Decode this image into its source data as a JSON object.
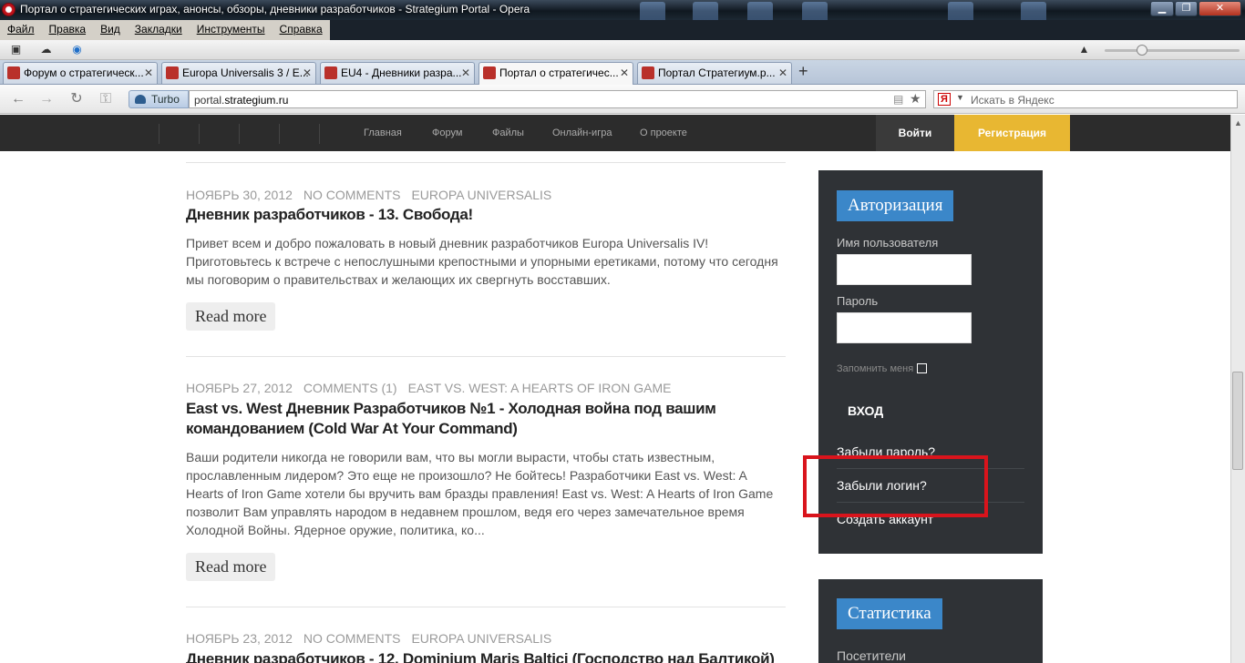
{
  "window": {
    "title": "Портал о стратегических играх, анонсы, обзоры, дневники разработчиков - Strategium Portal - Opera",
    "min_label": "▁",
    "max_label": "❐",
    "close_label": "✕"
  },
  "menu": [
    "Файл",
    "Правка",
    "Вид",
    "Закладки",
    "Инструменты",
    "Справка"
  ],
  "tabs": [
    {
      "label": "Форум о стратегическ..."
    },
    {
      "label": "Europa Universalis 3 / E..."
    },
    {
      "label": "EU4 - Дневники разра..."
    },
    {
      "label": "Портал о стратегичес..."
    },
    {
      "label": "Портал Стратегиум.р..."
    }
  ],
  "newtab_label": "+",
  "address": {
    "turbo_label": "Turbo",
    "url_prefix": "portal.",
    "url_domain": "strategium.ru",
    "search_badge": "Я",
    "search_placeholder": "Искать в Яндекс"
  },
  "site_nav": {
    "links": [
      "Главная",
      "Форум",
      "Файлы",
      "Онлайн-игра",
      "О проекте"
    ],
    "login": "Войти",
    "register": "Регистрация"
  },
  "posts": [
    {
      "date": "НОЯБРЬ 30, 2012",
      "comments": "NO COMMENTS",
      "category": "EUROPA UNIVERSALIS",
      "title": "Дневник разработчиков - 13. Свобода!",
      "excerpt": "Привет всем и добро пожаловать в новый дневник разработчиков Europa Universalis IV! Приготовьтесь к встрече с непослушными крепостными и упорными еретиками, потому что сегодня мы поговорим о правительствах и желающих их свергнуть восставших.",
      "read_more": "Read more"
    },
    {
      "date": "НОЯБРЬ 27, 2012",
      "comments": "COMMENTS (1)",
      "category": "EAST VS. WEST: A HEARTS OF IRON GAME",
      "title": "East vs. West Дневник Разработчиков №1 - Холодная война под вашим командованием (Cold War At Your Command)",
      "excerpt": "Ваши родители никогда не говорили вам, что вы могли вырасти, чтобы стать известным, прославленным лидером? Это еще не произошло? Не бойтесь! Разработчики East vs. West: A Hearts of Iron Game хотели бы вручить вам бразды правления! East vs. West: A Hearts of Iron Game позволит Вам управлять народом в недавнем прошлом, ведя его через замечательное время Холодной Войны. Ядерное оружие, политика, ко...",
      "read_more": "Read more"
    },
    {
      "date": "НОЯБРЬ 23, 2012",
      "comments": "NO COMMENTS",
      "category": "EUROPA UNIVERSALIS",
      "title": "Дневник разработчиков - 12. Dominium Maris Baltici (Господство над Балтикой)"
    }
  ],
  "auth": {
    "title": "Авторизация",
    "username_label": "Имя пользователя",
    "password_label": "Пароль",
    "remember": "Запомнить меня",
    "submit": "ВХОД",
    "forgot_password": "Забыли пароль?",
    "forgot_login": "Забыли логин?",
    "create_account": "Создать аккаунт"
  },
  "stats": {
    "title": "Статистика",
    "visitors": "Посетители"
  }
}
